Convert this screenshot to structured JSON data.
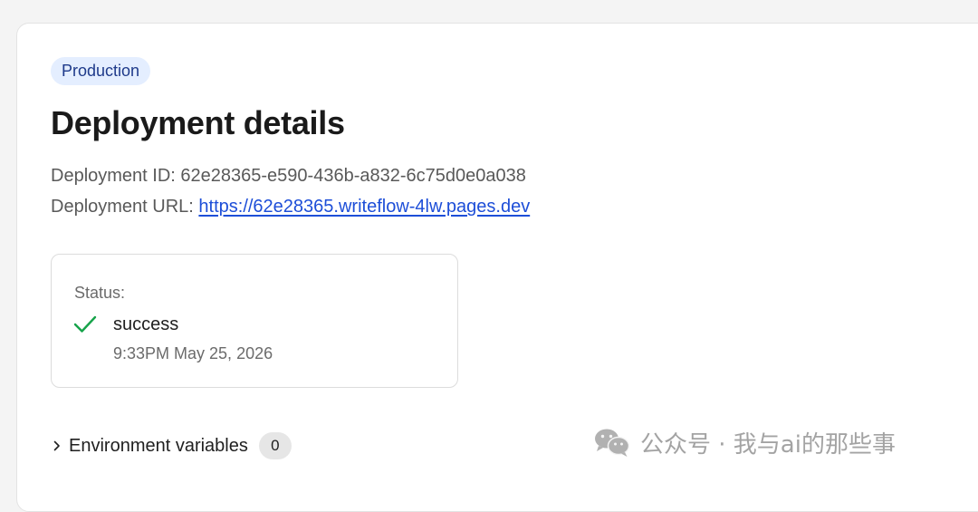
{
  "environment_badge": "Production",
  "page_title": "Deployment details",
  "deployment": {
    "id_label": "Deployment ID:",
    "id_value": "62e28365-e590-436b-a832-6c75d0e0a038",
    "url_label": "Deployment URL:",
    "url_value": "https://62e28365.writeflow-4lw.pages.dev"
  },
  "status": {
    "label": "Status:",
    "value": "success",
    "timestamp": "9:33PM May 25, 2026",
    "icon": "check-icon",
    "color": "#16a34a"
  },
  "environment_variables": {
    "label": "Environment variables",
    "count": "0",
    "icon": "chevron-right-icon"
  },
  "watermark": {
    "text": "公众号 · 我与ai的那些事",
    "icon": "wechat-icon"
  },
  "colors": {
    "badge_bg": "#e4eeff",
    "badge_text": "#1e3a8a",
    "link": "#1d4ed8",
    "success": "#16a34a"
  }
}
